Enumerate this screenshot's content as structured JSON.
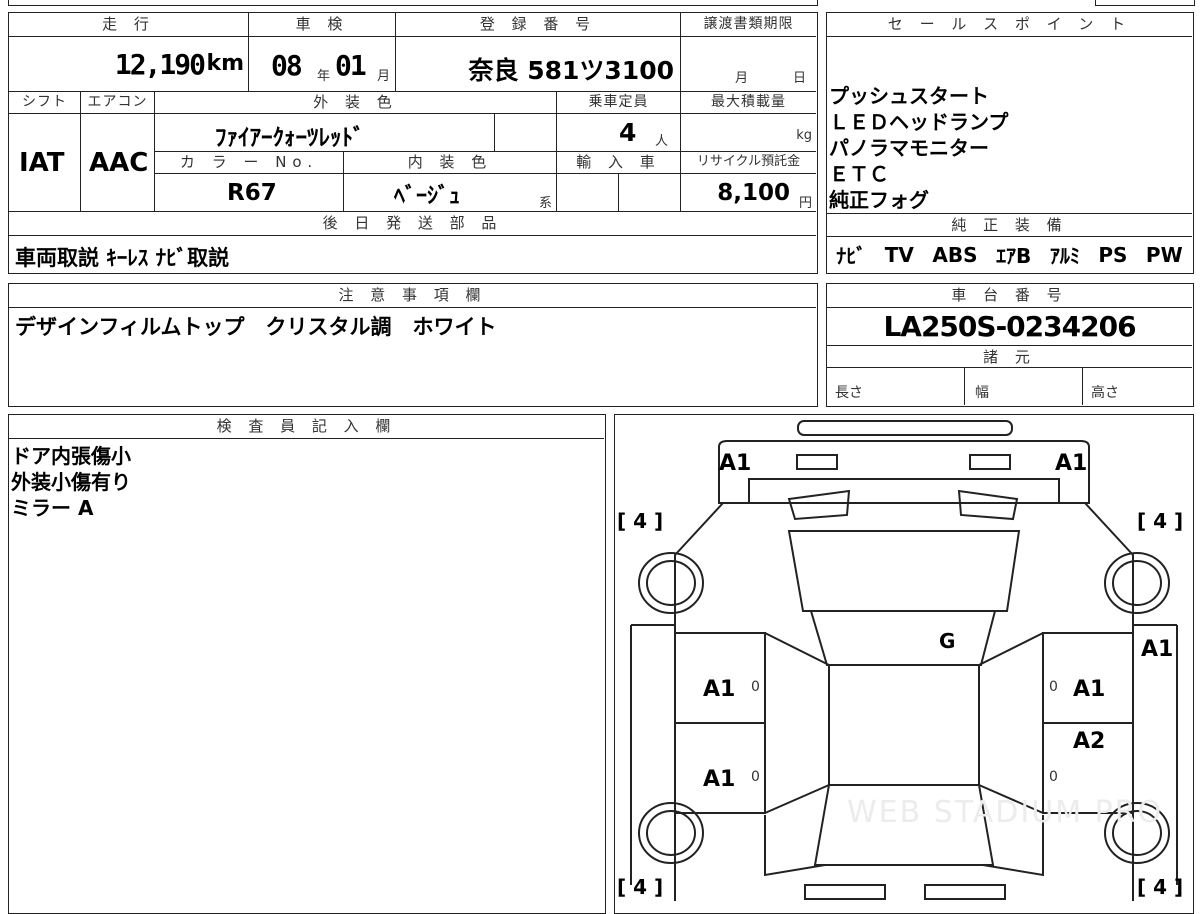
{
  "vehicle": {
    "mileage_header": "走 行",
    "mileage_value": "12,190",
    "mileage_unit": "km",
    "inspection_header": "車 検",
    "inspection_year": "08",
    "year_char": "年",
    "inspection_month": "01",
    "month_char": "月",
    "registration_header": "登 録 番 号",
    "registration_value": "奈良 581ツ3100",
    "transfer_header": "譲渡書類期限",
    "transfer_month_char": "月",
    "transfer_day_char": "日",
    "shift_header": "シフト",
    "shift_value": "IAT",
    "ac_header": "エアコン",
    "ac_value": "AAC",
    "exterior_color_header": "外 装 色",
    "exterior_color_value": "ﾌｧｲｱｰｸｫｰﾂﾚｯﾄﾞ",
    "capacity_header": "乗車定員",
    "capacity_value": "4",
    "capacity_unit": "人",
    "max_load_header": "最大積載量",
    "max_load_unit": "kg",
    "color_no_header": "カ ラ ー No.",
    "color_no_value": "R67",
    "interior_color_header": "内 装 色",
    "interior_color_value": "ﾍﾞｰｼﾞｭ",
    "interior_color_suffix": "系",
    "import_header": "輸 入 車",
    "recycle_header": "リサイクル預託金",
    "recycle_value": "8,100",
    "recycle_unit": "円",
    "later_parts_header": "後 日 発 送 部 品",
    "later_parts_value": "車両取説 ｷｰﾚｽ ﾅﾋﾞ取説"
  },
  "sales_points": {
    "header": "セ ー ル ス ポ イ ン ト",
    "items": [
      "プッシュスタート",
      "ＬＥＤヘッドランプ",
      "パノラマモニター",
      "ＥＴＣ",
      "純正フォグ"
    ]
  },
  "equipment": {
    "header": "純 正 装 備",
    "items": [
      "ﾅﾋﾞ",
      "TV",
      "ABS",
      "ｴｱB",
      "ｱﾙﾐ",
      "PS",
      "PW"
    ]
  },
  "notes": {
    "header": "注 意 事 項 欄",
    "value": "デザインフィルムトップ　クリスタル調　ホワイト"
  },
  "chassis": {
    "header": "車 台 番 号",
    "value": "LA250S-0234206",
    "spec_header": "諸 元",
    "length_label": "長さ",
    "width_label": "幅",
    "height_label": "高さ"
  },
  "inspector": {
    "header": "検 査 員 記 入 欄",
    "lines": [
      "ドア内張傷小",
      "外装小傷有り",
      "ミラー A"
    ]
  },
  "diagram": {
    "front_left": "A1",
    "front_right": "A1",
    "tire_fl": "[ 4 ]",
    "tire_fr": "[ 4 ]",
    "tire_rl": "[ 4 ]",
    "tire_rr": "[ 4 ]",
    "windshield": "G",
    "right_fender": "A1",
    "left_front_door": "A1",
    "left_rear_door": "A1",
    "right_front_door": "A1",
    "right_rear_door": "A2",
    "door_mark_lf": "0",
    "door_mark_lr": "0",
    "door_mark_rf": "0",
    "door_mark_rr": "0",
    "watermark": "WEB STADIUM PRO"
  }
}
